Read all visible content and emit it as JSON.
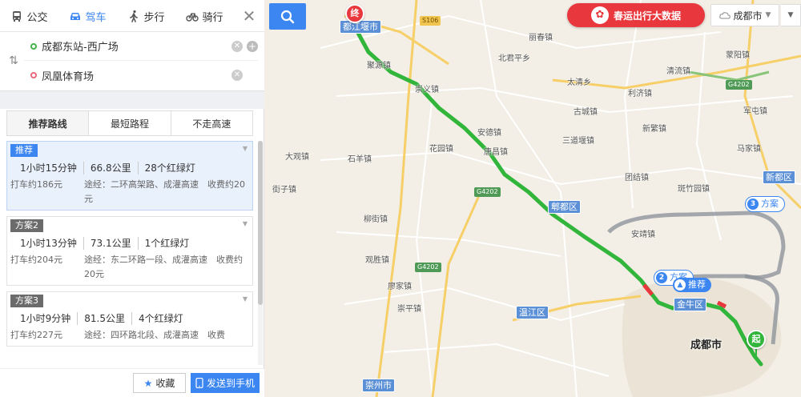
{
  "modes": [
    {
      "id": "transit",
      "label": "公交",
      "icon": "bus-icon"
    },
    {
      "id": "drive",
      "label": "驾车",
      "icon": "car-icon",
      "active": true
    },
    {
      "id": "walk",
      "label": "步行",
      "icon": "walker-icon"
    },
    {
      "id": "bike",
      "label": "骑行",
      "icon": "bicycle-icon"
    }
  ],
  "close_symbol": "✕",
  "swap_symbol": "⇅",
  "from_value": "成都东站-西广场",
  "to_value": "凤凰体育场",
  "strategy_tabs": [
    "推荐路线",
    "最短路程",
    "不走高速"
  ],
  "routes": [
    {
      "tag": "推荐",
      "time": "1小时15分钟",
      "distance": "66.8公里",
      "lights": "28个红绿灯",
      "taxi": "打车约186元",
      "via": "途经：二环高架路、成灌高速　收费约20元"
    },
    {
      "tag": "方案2",
      "time": "1小时13分钟",
      "distance": "73.1公里",
      "lights": "1个红绿灯",
      "taxi": "打车约204元",
      "via": "途经：东二环路一段、成灌高速　收费约20元"
    },
    {
      "tag": "方案3",
      "time": "1小时9分钟",
      "distance": "81.5公里",
      "lights": "4个红绿灯",
      "taxi": "打车约227元",
      "via": "途经：四环路北段、成灌高速　收费"
    }
  ],
  "footer": {
    "favorite": "收藏",
    "send": "发送到手机"
  },
  "banner": "春运出行大数据",
  "city": "成都市",
  "map": {
    "pins": {
      "start": "起",
      "end": "终"
    },
    "callouts": {
      "recommended": "推荐",
      "plan": "方案",
      "plan2_num": "2",
      "plan3_num": "3"
    },
    "city_label": "成都市",
    "districts": [
      "都江堰市",
      "郫都区",
      "金牛区",
      "新都区",
      "温江区",
      "崇州市"
    ],
    "places": [
      "丽春镇",
      "北君平乡",
      "太清乡",
      "古城镇",
      "三道堰镇",
      "利济镇",
      "清流镇",
      "蒙阳镇",
      "军屯镇",
      "新繁镇",
      "马家镇",
      "团结镇",
      "斑竹园镇",
      "安靖镇",
      "聚源镇",
      "崇义镇",
      "安德镇",
      "花园镇",
      "唐昌镇",
      "石羊镇",
      "大观镇",
      "街子镇",
      "柳街镇",
      "观胜镇",
      "廖家镇",
      "崇平镇"
    ],
    "roads": [
      "S106",
      "G4202",
      "G4202",
      "G4202"
    ],
    "colors": {
      "route_green": "#31b53a",
      "ring_gray": "#8f959c",
      "accent_blue": "#3b86f0",
      "banner_red": "#e8383d"
    }
  }
}
